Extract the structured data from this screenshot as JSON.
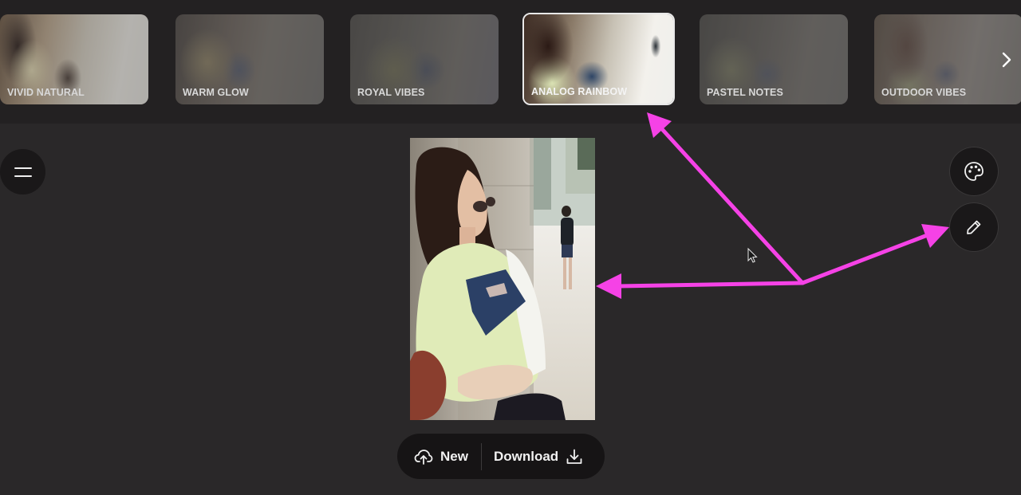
{
  "filters": [
    {
      "label": "VIVID NATURAL",
      "selected": false
    },
    {
      "label": "WARM GLOW",
      "selected": false
    },
    {
      "label": "ROYAL VIBES",
      "selected": false
    },
    {
      "label": "ANALOG RAINBOW",
      "selected": true
    },
    {
      "label": "PASTEL NOTES",
      "selected": false
    },
    {
      "label": "OUTDOOR VIBES",
      "selected": false
    }
  ],
  "actions": {
    "new_label": "New",
    "download_label": "Download"
  },
  "icons": {
    "menu": "menu-icon",
    "palette": "palette-icon",
    "edit": "pencil-icon",
    "upload": "cloud-upload-icon",
    "download": "download-icon",
    "next": "chevron-right-icon"
  },
  "colors": {
    "background": "#2a2829",
    "topbar": "#232122",
    "annotation_arrow": "#f542e6",
    "button_bg": "#1a1819"
  }
}
